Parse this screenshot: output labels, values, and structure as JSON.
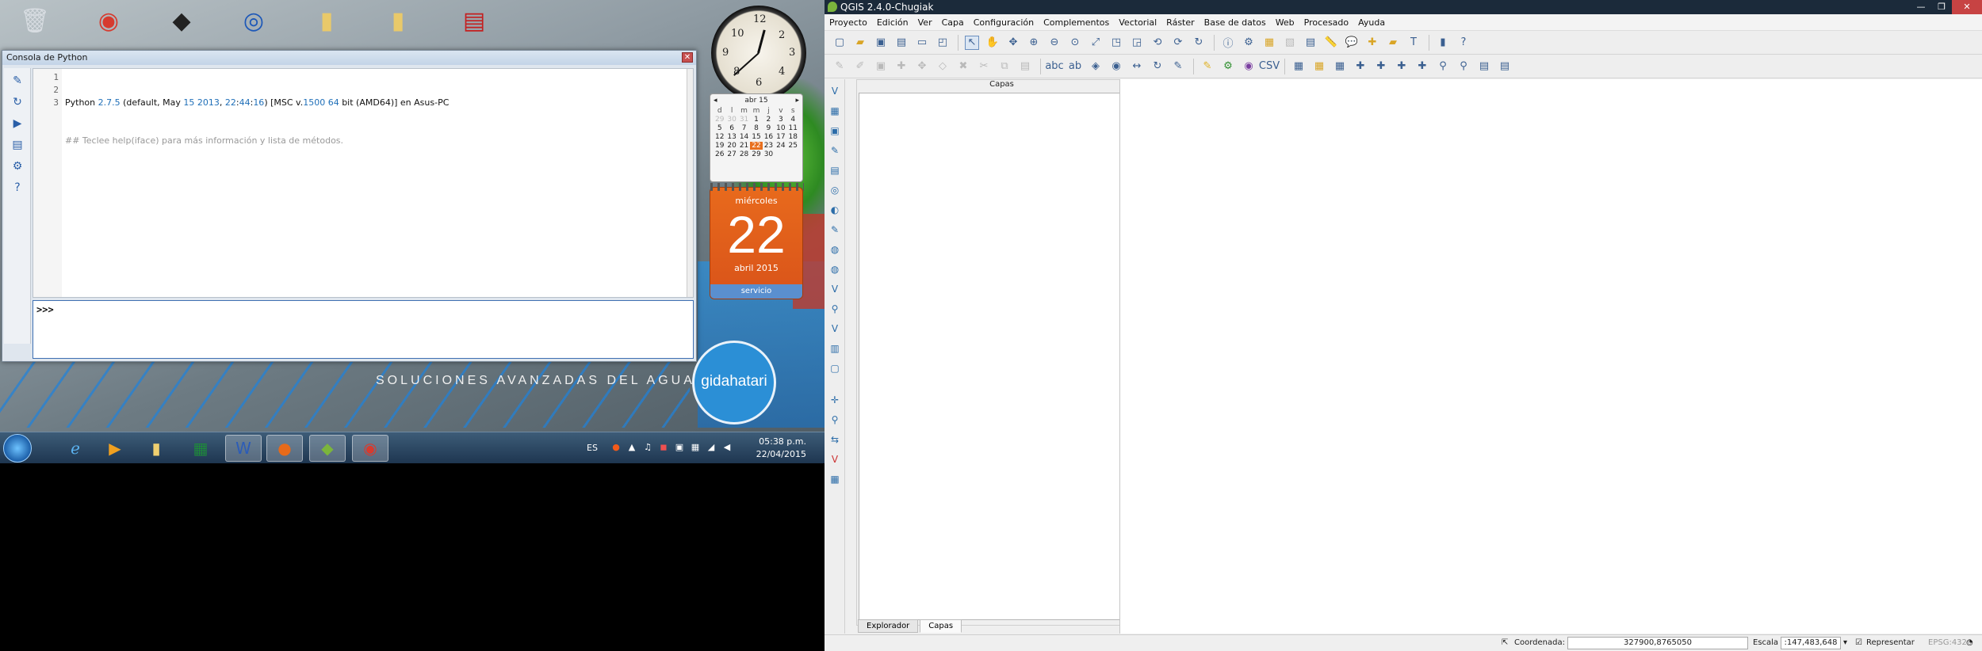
{
  "python_console": {
    "title": "Consola de Python",
    "close": "✕",
    "line_numbers": [
      "1",
      "2",
      "3"
    ],
    "line1": {
      "a": "Python ",
      "version": "2.7.5",
      "b": " (default, May ",
      "day": "15",
      "c": " ",
      "year": "2013",
      "d": ", ",
      "h": "22",
      "e": ":",
      "m": "44",
      "f": ":",
      "s": "16",
      "g": ") [MSC v.",
      "msc": "1500",
      "h2": " ",
      "bits": "64",
      "i": " bit (AMD64)] en Asus-PC"
    },
    "line2": "## Teclee help(iface) para más información y lista de métodos.",
    "prompt": ">>>"
  },
  "calendar": {
    "header": "abr 15",
    "prev": "◂",
    "next": "▸",
    "day_headers": [
      "d",
      "l",
      "m",
      "m",
      "j",
      "v",
      "s"
    ],
    "rows": [
      [
        "29",
        "30",
        "31",
        "1",
        "2",
        "3",
        "4"
      ],
      [
        "5",
        "6",
        "7",
        "8",
        "9",
        "10",
        "11"
      ],
      [
        "12",
        "13",
        "14",
        "15",
        "16",
        "17",
        "18"
      ],
      [
        "19",
        "20",
        "21",
        "22",
        "23",
        "24",
        "25"
      ],
      [
        "26",
        "27",
        "28",
        "29",
        "30",
        "",
        ""
      ]
    ],
    "today": "22"
  },
  "date_card": {
    "weekday": "miércoles",
    "day": "22",
    "month_year": "abril 2015",
    "note": "servicio"
  },
  "wallpaper": {
    "tagline": "SOLUCIONES AVANZADAS DEL AGUA",
    "brand": "gidahatari"
  },
  "taskbar": {
    "lang": "ES",
    "time": "05:38 p.m.",
    "date": "22/04/2015"
  },
  "qgis": {
    "title": "QGIS 2.4.0-Chugiak",
    "win_min": "—",
    "win_max": "❐",
    "win_close": "✕",
    "menus": [
      "Proyecto",
      "Edición",
      "Ver",
      "Capa",
      "Configuración",
      "Complementos",
      "Vectorial",
      "Ráster",
      "Base de datos",
      "Web",
      "Procesado",
      "Ayuda"
    ],
    "layers_title": "Capas",
    "layers_btns": "⧉✕",
    "tabs": [
      "Explorador",
      "Capas"
    ],
    "status": {
      "coord_label": "Coordenada:",
      "coord_value": "327900,8765050",
      "scale_label": "Escala",
      "scale_value": ":147,483,648",
      "render_label": "Representar",
      "epsg": "EPSG:4326"
    }
  }
}
